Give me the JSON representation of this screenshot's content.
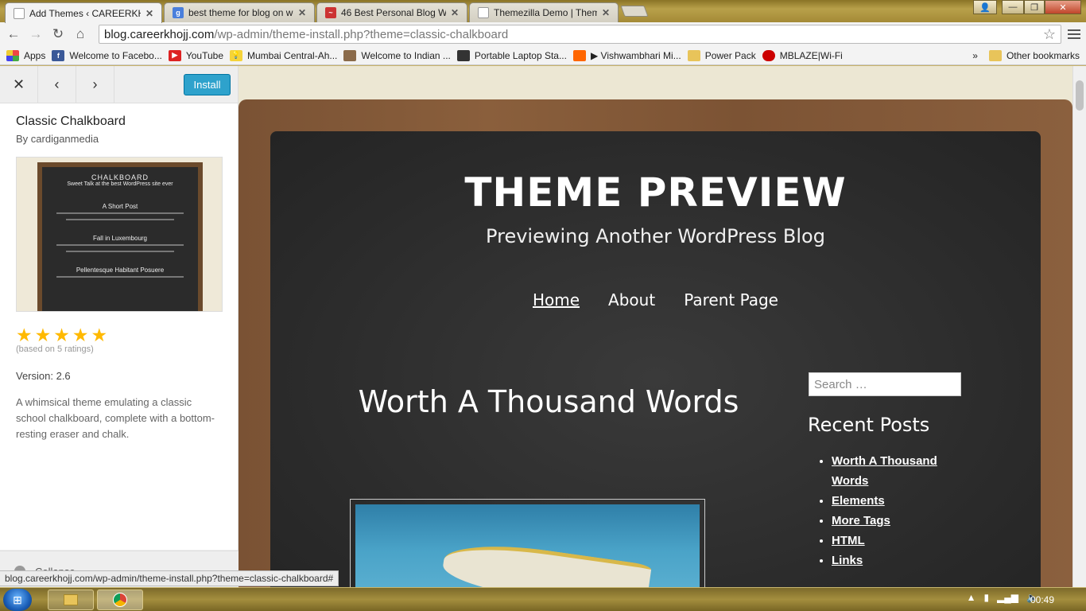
{
  "browser": {
    "tabs": [
      {
        "label": "Add Themes ‹ CAREERKHOJJ",
        "favicon": "page-icon",
        "active": true
      },
      {
        "label": "best theme for blog on wo",
        "favicon": "google-icon",
        "active": false
      },
      {
        "label": "46 Best Personal Blog Wor",
        "favicon": "site-icon",
        "active": false
      },
      {
        "label": "Themezilla Demo | Theme",
        "favicon": "page-icon",
        "active": false
      }
    ],
    "tab_close_glyph": "✕",
    "url_host": "blog.careerkhojj.com",
    "url_path": "/wp-admin/theme-install.php?theme=classic-chalkboard",
    "bookmarks": [
      {
        "label": "Apps",
        "icon": "apps-grid-icon"
      },
      {
        "label": "Welcome to Facebo...",
        "icon": "facebook-icon"
      },
      {
        "label": "YouTube",
        "icon": "youtube-icon"
      },
      {
        "label": "Mumbai Central-Ah...",
        "icon": "bulb-icon"
      },
      {
        "label": "Welcome to Indian ...",
        "icon": "indian-site-icon"
      },
      {
        "label": "Portable Laptop Sta...",
        "icon": "laptop-icon"
      },
      {
        "label": "▶ Vishwambhari Mi...",
        "icon": "soundcloud-icon"
      },
      {
        "label": "Power Pack",
        "icon": "folder-icon"
      },
      {
        "label": "MBLAZE|Wi-Fi",
        "icon": "mblaze-icon"
      }
    ],
    "bookmarks_overflow": "»",
    "other_bookmarks": "Other bookmarks",
    "status_url": "blog.careerkhojj.com/wp-admin/theme-install.php?theme=classic-chalkboard#"
  },
  "panel": {
    "close_glyph": "✕",
    "prev_glyph": "‹",
    "next_glyph": "›",
    "install_label": "Install",
    "theme_name": "Classic Chalkboard",
    "author": "By cardiganmedia",
    "rating_stars": 5,
    "ratings_text": "(based on 5 ratings)",
    "version": "Version: 2.6",
    "description": "A whimsical theme emulating a classic school chalkboard, complete with a bottom-resting eraser and chalk.",
    "collapse_label": "Collapse",
    "thumbnail": {
      "title": "CHALKBOARD",
      "subtitle": "Sweet Talk at the best WordPress site ever",
      "post1": "A Short Post",
      "post2": "Fall in Luxembourg",
      "post3": "Pellentesque Habitant Posuere"
    }
  },
  "preview": {
    "site_title": "THEME PREVIEW",
    "site_description": "Previewing Another WordPress Blog",
    "nav": [
      "Home",
      "About",
      "Parent Page"
    ],
    "post_title": "Worth A Thousand Words",
    "search_placeholder": "Search …",
    "widget_title": "Recent Posts",
    "recent_posts": [
      "Worth A Thousand Words",
      "Elements",
      "More Tags",
      "HTML",
      "Links"
    ]
  },
  "taskbar": {
    "clock": "00:49"
  },
  "colors": {
    "install_button": "#2ea2cc",
    "star": "#ffb900",
    "chalkboard": "#2a2a2a",
    "wood": "#7a5234"
  }
}
